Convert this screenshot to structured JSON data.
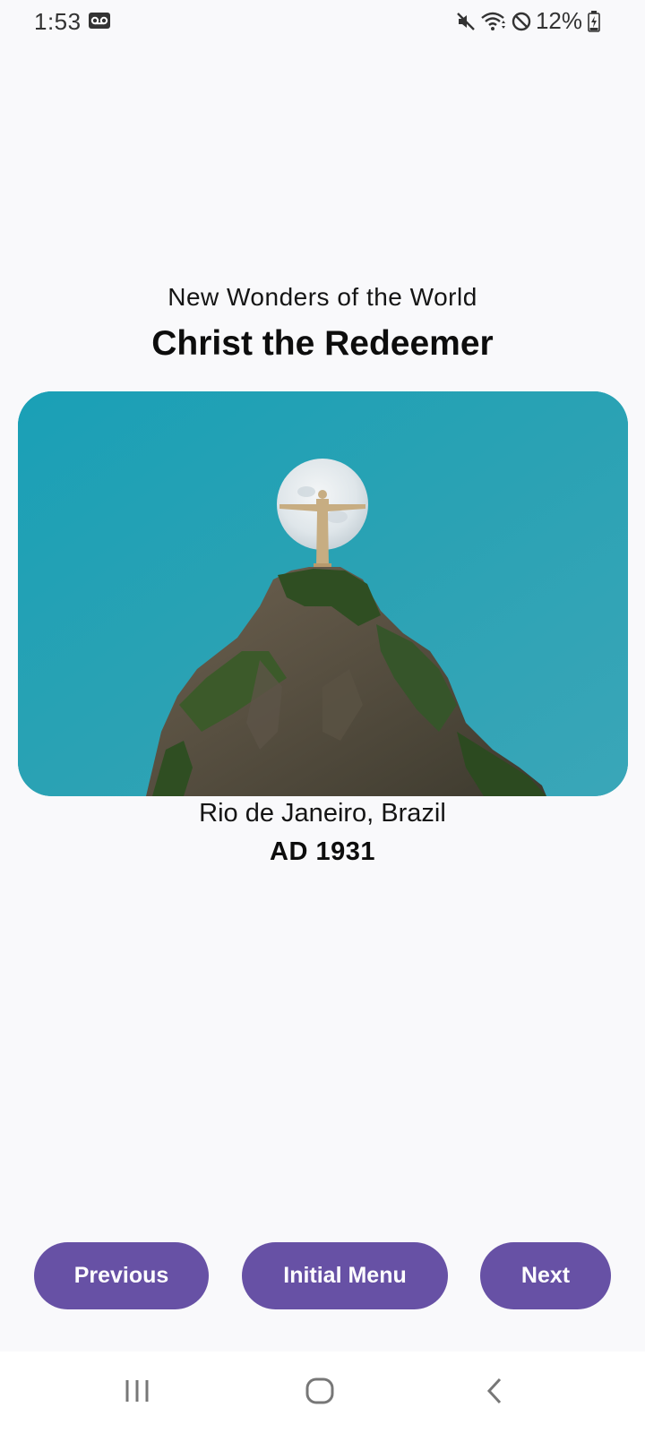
{
  "status_bar": {
    "time": "1:53",
    "battery_percent": "12%",
    "icons": [
      "voicemail-icon",
      "mute-icon",
      "wifi-icon",
      "blocked-icon",
      "battery-charging-icon"
    ]
  },
  "header": {
    "subtitle": "New Wonders of the World",
    "title": "Christ the Redeemer"
  },
  "photo": {
    "subject": "Christ the Redeemer statue on a mountain peak in front of the moon",
    "sky_color": "#1a9eb5"
  },
  "details": {
    "location": "Rio de Janeiro, Brazil",
    "date": "AD 1931"
  },
  "buttons": {
    "previous_label": "Previous",
    "menu_label": "Initial Menu",
    "next_label": "Next",
    "color": "#6751a5"
  },
  "system_nav": {
    "icons": [
      "recent-apps-icon",
      "home-icon",
      "back-icon"
    ]
  }
}
